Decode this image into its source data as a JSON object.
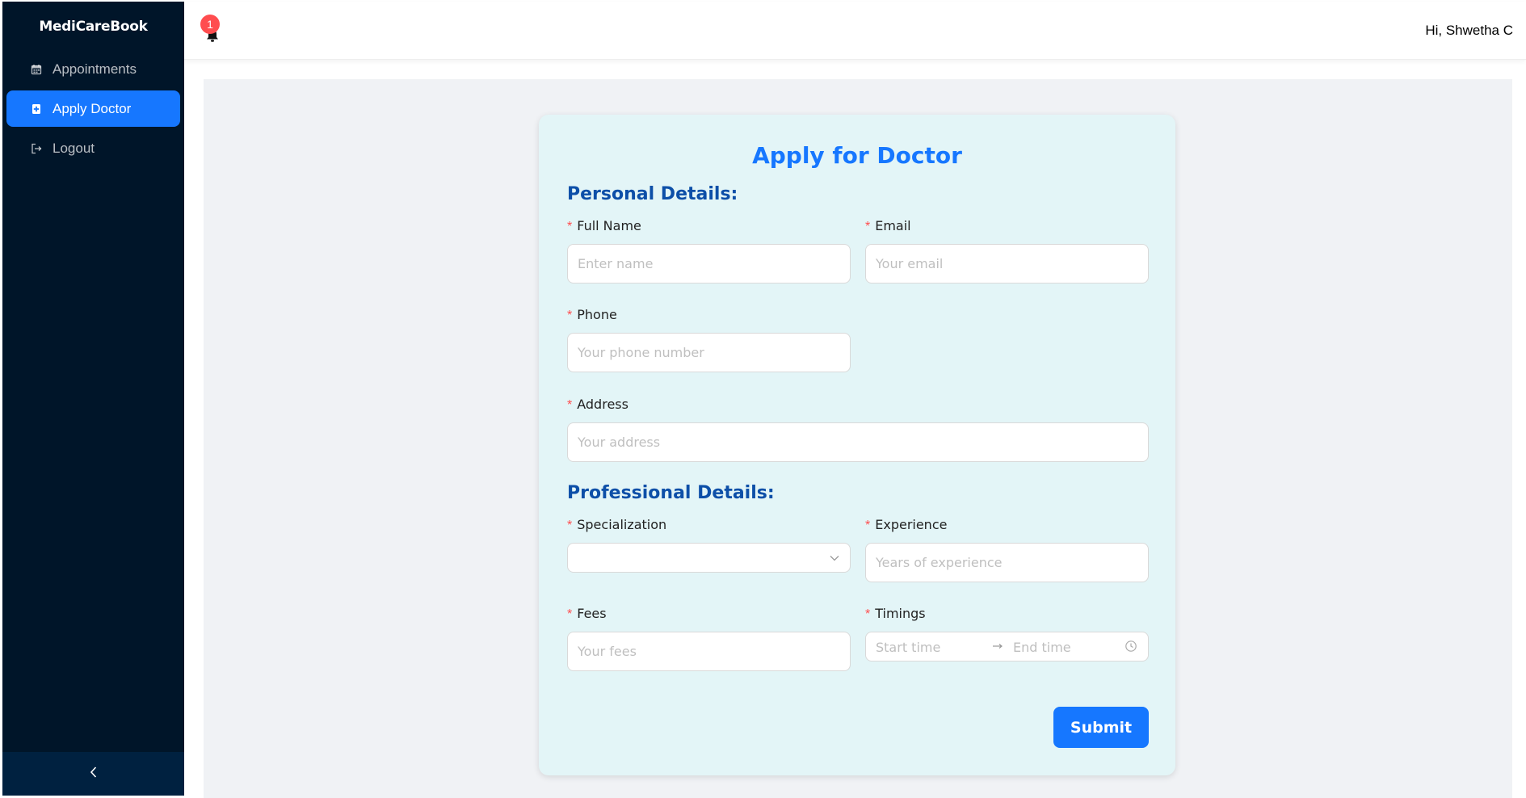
{
  "app": {
    "brand": "MediCareBook"
  },
  "sidebar": {
    "items": [
      {
        "label": "Appointments",
        "icon": "calendar-icon",
        "active": false
      },
      {
        "label": "Apply Doctor",
        "icon": "medical-plus-icon",
        "active": true
      },
      {
        "label": "Logout",
        "icon": "logout-icon",
        "active": false
      }
    ],
    "collapse_icon": "chevron-left-icon"
  },
  "header": {
    "notification_count": "1",
    "notification_icon": "bell-icon",
    "greeting": "Hi, Shwetha C"
  },
  "form": {
    "title": "Apply for Doctor",
    "personal_section": "Personal Details:",
    "professional_section": "Professional Details:",
    "required_mark": "*",
    "fields": {
      "full_name": {
        "label": "Full Name",
        "placeholder": "Enter name"
      },
      "email": {
        "label": "Email",
        "placeholder": "Your email"
      },
      "phone": {
        "label": "Phone",
        "placeholder": "Your phone number"
      },
      "address": {
        "label": "Address",
        "placeholder": "Your address"
      },
      "specialization": {
        "label": "Specialization",
        "value": ""
      },
      "experience": {
        "label": "Experience",
        "placeholder": "Years of experience"
      },
      "fees": {
        "label": "Fees",
        "placeholder": "Your fees"
      },
      "timings": {
        "label": "Timings",
        "start_placeholder": "Start time",
        "end_placeholder": "End time"
      }
    },
    "submit_label": "Submit"
  },
  "colors": {
    "sidebar_bg": "#001529",
    "accent": "#1677ff",
    "card_bg": "#e3f5f7",
    "required": "#ff4d4f",
    "section_title": "#0d4fa8"
  }
}
